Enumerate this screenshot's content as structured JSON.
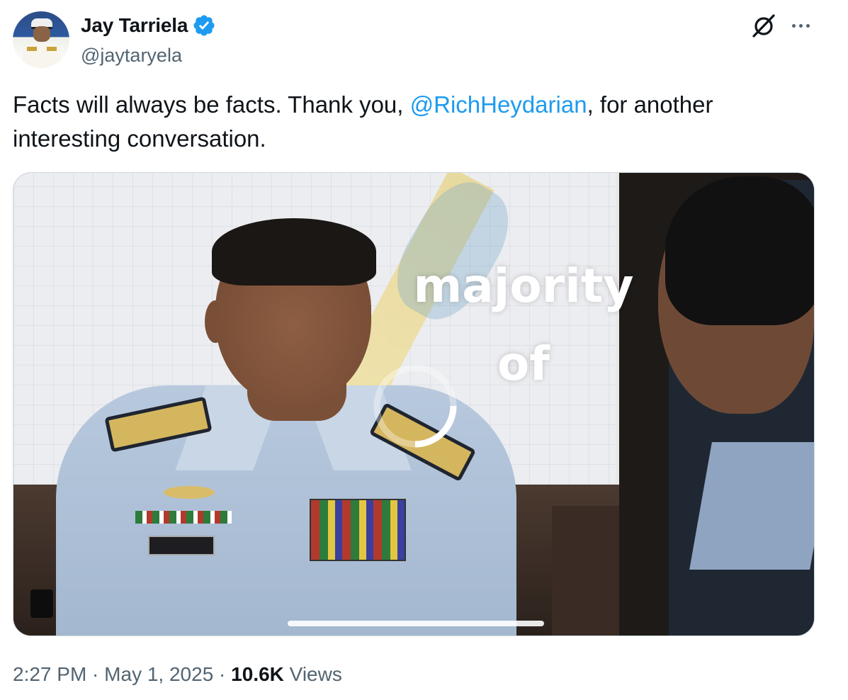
{
  "author": {
    "display_name": "Jay Tarriela",
    "handle": "@jaytaryela",
    "verified": true,
    "verified_color": "#1d9bf0"
  },
  "header_icons": [
    "grok-icon",
    "more-icon"
  ],
  "tweet": {
    "text_before": "Facts will always be facts. Thank you, ",
    "mention": "@RichHeydarian",
    "text_after": ", for another interesting conversation.",
    "mention_color": "#1d9bf0"
  },
  "media": {
    "overlay_line1": "majority",
    "overlay_line2": "of",
    "loading": true
  },
  "meta": {
    "time": "2:27 PM",
    "separator": " · ",
    "date": "May 1, 2025",
    "views_count": "10.6K",
    "views_label": " Views"
  }
}
